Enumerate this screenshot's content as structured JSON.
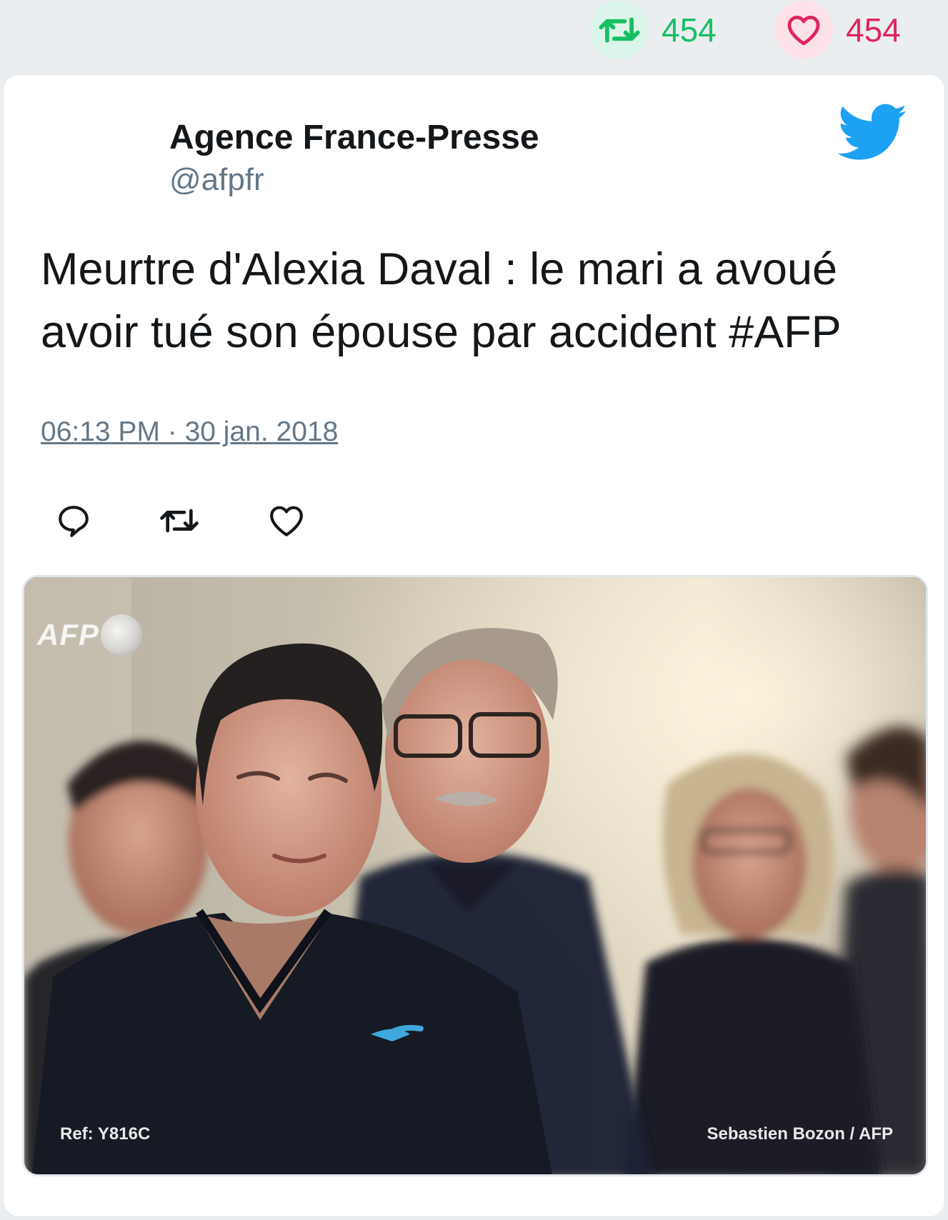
{
  "top_stats": {
    "retweets": {
      "count": "454",
      "icon": "retweet-icon",
      "color": "#17bf63"
    },
    "likes": {
      "count": "454",
      "icon": "heart-icon",
      "color": "#e0245e"
    }
  },
  "tweet": {
    "author_name": "Agence France-Presse",
    "author_handle": "@afpfr",
    "text": "Meurtre d'Alexia Daval : le mari a avoué avoir tué son épouse par accident #AFP",
    "timestamp": "06:13 PM · 30 jan. 2018",
    "brand_icon": "twitter-bird-icon",
    "brand_color": "#1da1f2",
    "actions": [
      "reply-icon",
      "retweet-icon",
      "like-icon"
    ]
  },
  "media": {
    "watermark": "AFP",
    "ref": "Ref: Y816C",
    "credit": "Sebastien Bozon / AFP"
  }
}
